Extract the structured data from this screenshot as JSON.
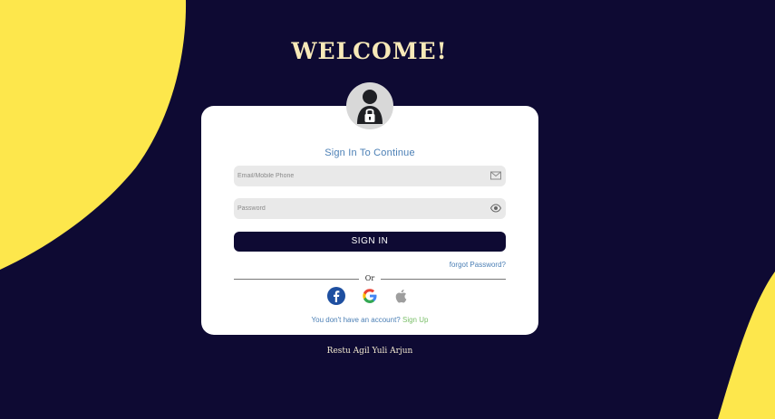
{
  "header": {
    "title": "WELCOME!"
  },
  "card": {
    "title": "Sign In To Continue",
    "email_placeholder": "Email/Mobile Phone",
    "password_placeholder": "Password",
    "signin_label": "SIGN IN",
    "forgot_label": "forgot Password?",
    "divider_label": "Or",
    "signup_prompt": "You don't have an account?",
    "signup_link": "Sign Up"
  },
  "social": [
    {
      "name": "facebook",
      "icon": "facebook-icon"
    },
    {
      "name": "google",
      "icon": "google-icon"
    },
    {
      "name": "apple",
      "icon": "apple-icon"
    }
  ],
  "footer": {
    "credit": "Restu Agil Yuli Arjun"
  },
  "colors": {
    "background": "#0e0a33",
    "accent_yellow": "#fde74c",
    "card": "#ffffff",
    "link_blue": "#4b7fb5",
    "signup_green": "#7bbf6a",
    "title_cream": "#f7e9b8"
  }
}
